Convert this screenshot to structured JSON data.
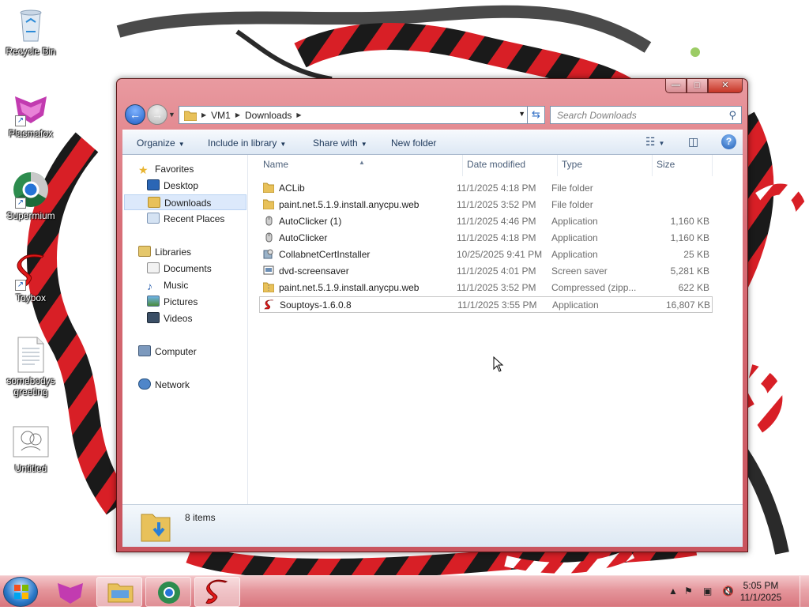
{
  "desktop": {
    "icons": [
      {
        "label": "Recycle Bin",
        "icon": "recycle-bin-icon"
      },
      {
        "label": "Plasmafox",
        "icon": "plasmafox-icon"
      },
      {
        "label": "Supermium",
        "icon": "supermium-icon"
      },
      {
        "label": "Toybox",
        "icon": "toybox-icon"
      },
      {
        "label": "somebodys greeting",
        "icon": "text-file-icon"
      },
      {
        "label": "Untitled",
        "icon": "untitled-image-icon"
      }
    ]
  },
  "window": {
    "address": {
      "segments": [
        "VM1",
        "Downloads"
      ]
    },
    "search": {
      "placeholder": "Search Downloads"
    },
    "toolbar": {
      "organize": "Organize",
      "include_in_library": "Include in library",
      "share_with": "Share with",
      "new_folder": "New folder"
    },
    "navpane": {
      "favorites": "Favorites",
      "desktop": "Desktop",
      "downloads": "Downloads",
      "recent_places": "Recent Places",
      "libraries": "Libraries",
      "documents": "Documents",
      "music": "Music",
      "pictures": "Pictures",
      "videos": "Videos",
      "computer": "Computer",
      "network": "Network",
      "selected": "Downloads"
    },
    "columns": {
      "name": "Name",
      "date": "Date modified",
      "type": "Type",
      "size": "Size"
    },
    "files": [
      {
        "name": "ACLib",
        "date": "11/1/2025 4:18 PM",
        "type": "File folder",
        "size": "",
        "icon": "folder-icon"
      },
      {
        "name": "paint.net.5.1.9.install.anycpu.web",
        "date": "11/1/2025 3:52 PM",
        "type": "File folder",
        "size": "",
        "icon": "folder-icon"
      },
      {
        "name": "AutoClicker (1)",
        "date": "11/1/2025 4:46 PM",
        "type": "Application",
        "size": "1,160 KB",
        "icon": "mouse-icon"
      },
      {
        "name": "AutoClicker",
        "date": "11/1/2025 4:18 PM",
        "type": "Application",
        "size": "1,160 KB",
        "icon": "mouse-icon"
      },
      {
        "name": "CollabnetCertInstaller",
        "date": "10/25/2025 9:41 PM",
        "type": "Application",
        "size": "25 KB",
        "icon": "installer-icon"
      },
      {
        "name": "dvd-screensaver",
        "date": "11/1/2025 4:01 PM",
        "type": "Screen saver",
        "size": "5,281 KB",
        "icon": "screensaver-icon"
      },
      {
        "name": "paint.net.5.1.9.install.anycpu.web",
        "date": "11/1/2025 3:52 PM",
        "type": "Compressed (zipp...",
        "size": "622 KB",
        "icon": "zip-folder-icon"
      },
      {
        "name": "Souptoys-1.6.0.8",
        "date": "11/1/2025 3:55 PM",
        "type": "Application",
        "size": "16,807 KB",
        "icon": "souptoys-icon"
      }
    ],
    "details": {
      "count": "8 items"
    }
  },
  "taskbar": {
    "clock_time": "5:05 PM",
    "clock_date": "11/1/2025"
  }
}
